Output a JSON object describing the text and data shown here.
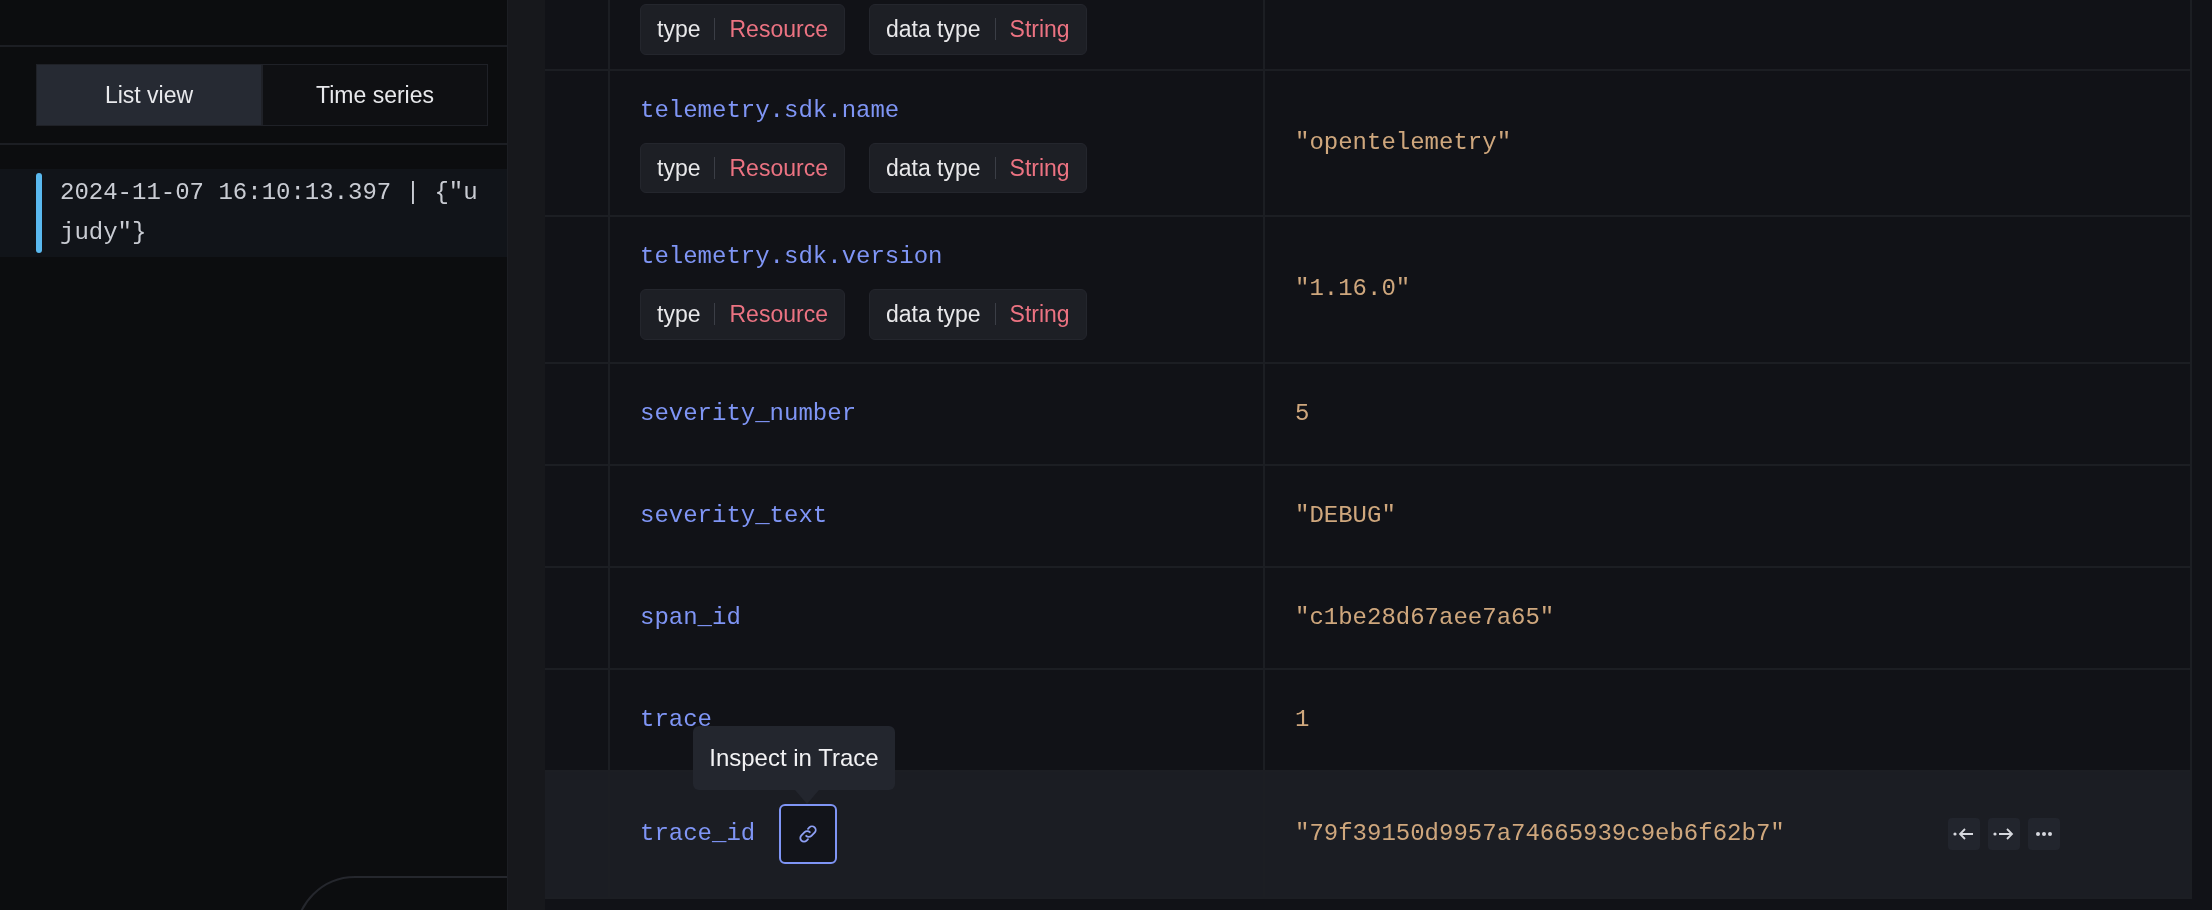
{
  "left_panel": {
    "tabs": [
      {
        "label": "List view",
        "selected": true
      },
      {
        "label": "Time series",
        "selected": false
      }
    ],
    "log_lines": [
      {
        "lines": [
          "2024-11-07 16:10:13.397 | {\"u",
          "judy\"}"
        ],
        "selected": true
      }
    ]
  },
  "drawer": {
    "rows": [
      {
        "tags": [
          {
            "label": "type",
            "value": "Resource"
          },
          {
            "label": "data type",
            "value": "String"
          }
        ],
        "selected": false
      },
      {
        "key": "telemetry.sdk.name",
        "tags": [
          {
            "label": "type",
            "value": "Resource"
          },
          {
            "label": "data type",
            "value": "String"
          }
        ],
        "value": "\"opentelemetry\"",
        "selected": false
      },
      {
        "key": "telemetry.sdk.version",
        "tags": [
          {
            "label": "type",
            "value": "Resource"
          },
          {
            "label": "data type",
            "value": "String"
          }
        ],
        "value": "\"1.16.0\"",
        "selected": false
      },
      {
        "key": "severity_number",
        "value": "5",
        "selected": false
      },
      {
        "key": "severity_text",
        "value": "\"DEBUG\"",
        "selected": false
      },
      {
        "key": "span_id",
        "value": "\"c1be28d67aee7a65\"",
        "selected": false
      },
      {
        "key": "trace",
        "value": "1",
        "selected": false
      },
      {
        "key": "trace_id",
        "link_tooltip": "Inspect in Trace",
        "value": "\"79f39150d9957a74665939c9eb6f62b7\"",
        "selected": true,
        "actions": [
          {
            "kind": "filter-out"
          },
          {
            "kind": "filter-for"
          },
          {
            "kind": "more"
          }
        ]
      }
    ]
  }
}
